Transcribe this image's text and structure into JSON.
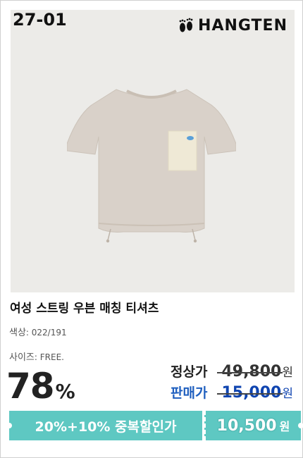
{
  "product": {
    "code": "27-01",
    "brand": "HANGTEN",
    "brand_icon": "footprints-icon",
    "name": "여성 스트링 우븐 매칭 티셔츠",
    "color_label": "색상",
    "color_value": ": 022/191",
    "size_label": "사이즈",
    "size_value": ": FREE."
  },
  "pricing": {
    "discount_number": "78",
    "discount_symbol": "%",
    "regular_label": "정상가",
    "regular_price": "49,800",
    "sale_label": "판매가",
    "sale_price": "15,000",
    "currency": "원"
  },
  "promo": {
    "text": "20%+10% 중복할인가",
    "final_price": "10,500",
    "currency": "원",
    "color": "#5ec8c2"
  },
  "colors": {
    "accent_blue": "#0f44b0",
    "banner_teal": "#5ec8c2",
    "shirt": "#d9d1c9",
    "pocket": "#efe9d6"
  }
}
